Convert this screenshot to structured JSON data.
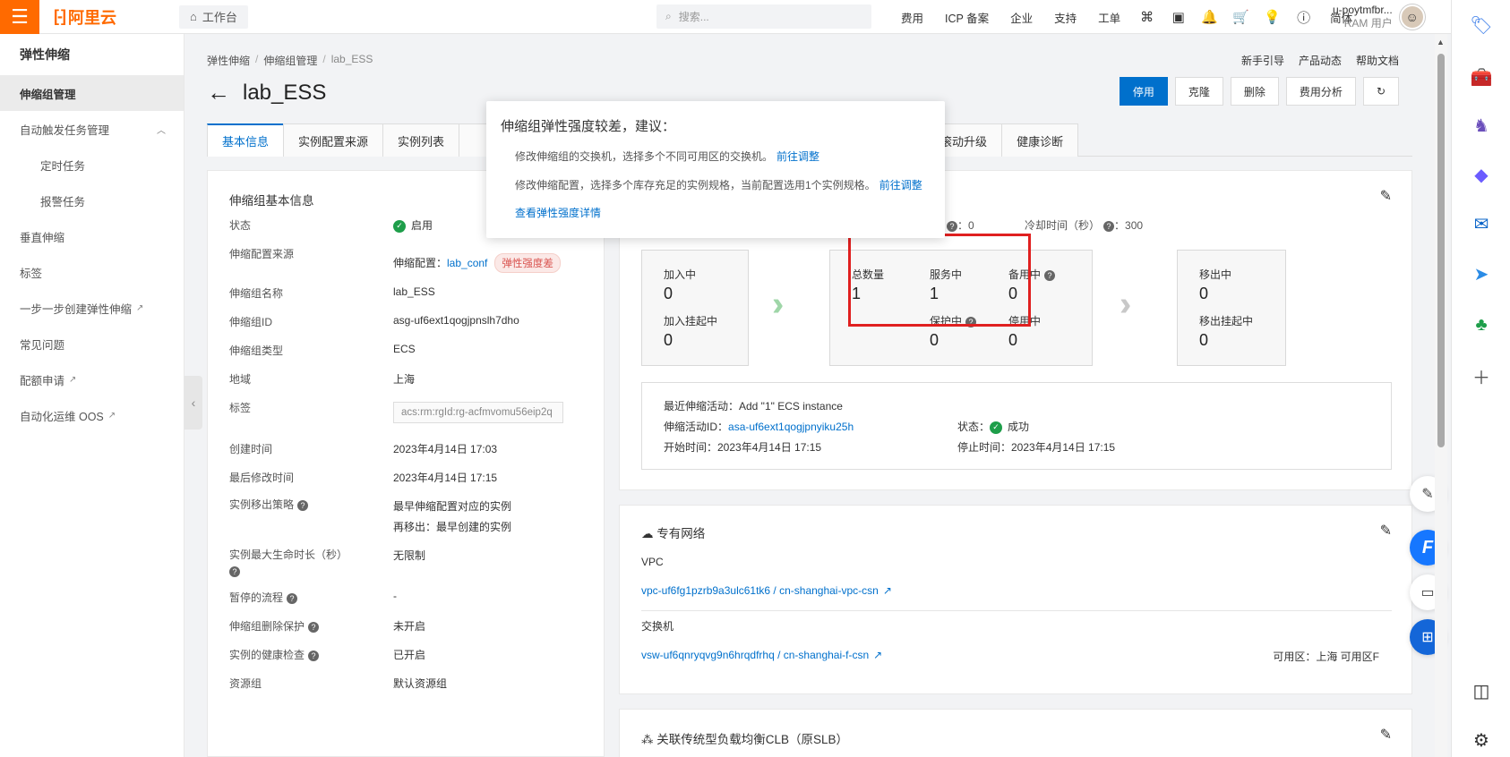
{
  "topbar": {
    "logo": "阿里云",
    "workbench": "工作台",
    "search_placeholder": "搜索...",
    "nav": [
      "费用",
      "ICP 备案",
      "企业",
      "支持",
      "工单"
    ],
    "user_name": "u-poytmfbr...",
    "user_role": "RAM 用户",
    "lang": "简体"
  },
  "sidebar": {
    "title": "弹性伸缩",
    "items": [
      {
        "label": "伸缩组管理"
      },
      {
        "label": "自动触发任务管理"
      },
      {
        "label": "定时任务"
      },
      {
        "label": "报警任务"
      },
      {
        "label": "垂直伸缩"
      },
      {
        "label": "标签"
      },
      {
        "label": "一步一步创建弹性伸缩"
      },
      {
        "label": "常见问题"
      },
      {
        "label": "配额申请"
      },
      {
        "label": "自动化运维 OOS"
      }
    ]
  },
  "breadcrumb": [
    "弹性伸缩",
    "伸缩组管理",
    "lab_ESS"
  ],
  "help_links": [
    "新手引导",
    "产品动态",
    "帮助文档"
  ],
  "page_title": "lab_ESS",
  "actions": [
    "停用",
    "克隆",
    "删除",
    "费用分析"
  ],
  "tabs": [
    "基本信息",
    "实例配置来源",
    "实例列表",
    "滚动升级",
    "健康诊断"
  ],
  "basic": {
    "title": "伸缩组基本信息",
    "rows": [
      {
        "k": "状态",
        "v": "启用"
      },
      {
        "k": "伸缩配置来源",
        "v_prefix": "伸缩配置：",
        "v_link": "lab_conf",
        "v_tag": "弹性强度差"
      },
      {
        "k": "伸缩组名称",
        "v": "lab_ESS"
      },
      {
        "k": "伸缩组ID",
        "v": "asg-uf6ext1qogjpnslh7dho"
      },
      {
        "k": "伸缩组类型",
        "v": "ECS"
      },
      {
        "k": "地域",
        "v": "上海"
      },
      {
        "k": "标签",
        "v": "acs:rm:rgId:rg-acfmvomu56eip2q"
      },
      {
        "k": "创建时间",
        "v": "2023年4月14日 17:03"
      },
      {
        "k": "最后修改时间",
        "v": "2023年4月14日 17:15"
      },
      {
        "k": "实例移出策略",
        "v": "最早伸缩配置对应的实例",
        "v2": "再移出：最早创建的实例"
      },
      {
        "k": "实例最大生命时长（秒）",
        "v": "无限制"
      },
      {
        "k": "暂停的流程",
        "v": "-"
      },
      {
        "k": "伸缩组删除保护",
        "v": "未开启"
      },
      {
        "k": "实例的健康检查",
        "v": "已开启"
      },
      {
        "k": "资源组",
        "v": "默认资源组"
      }
    ]
  },
  "status": {
    "expected_suffix": "：0",
    "cooldown_label": "冷却时间（秒）",
    "cooldown_value": "：300",
    "adding": "加入中",
    "adding_val": "0",
    "adding_pending": "加入挂起中",
    "adding_pending_val": "0",
    "total": "总数量",
    "total_val": "1",
    "in_service": "服务中",
    "in_service_val": "1",
    "standby": "备用中",
    "standby_val": "0",
    "protected": "保护中",
    "protected_val": "0",
    "stopped": "停用中",
    "stopped_val": "0",
    "removing": "移出中",
    "removing_val": "0",
    "removing_pending": "移出挂起中",
    "removing_pending_val": "0",
    "recent_activity": "最近伸缩活动：Add \"1\" ECS instance",
    "activity_id_label": "伸缩活动ID：",
    "activity_id": "asa-uf6ext1qogjpnyiku25h",
    "act_status_label": "状态：",
    "act_status": "成功",
    "start_time": "开始时间：2023年4月14日 17:15",
    "stop_time": "停止时间：2023年4月14日 17:15"
  },
  "vpc": {
    "title": "专有网络",
    "vpc_label": "VPC",
    "vpc_link": "vpc-uf6fg1pzrb9a3ulc61tk6 / cn-shanghai-vpc-csn",
    "vsw_label": "交换机",
    "vsw_link": "vsw-uf6qnryqvg9n6hrqdfrhq / cn-shanghai-f-csn",
    "zone": "可用区：上海 可用区F"
  },
  "clb": {
    "title": "关联传统型负载均衡CLB（原SLB）"
  },
  "popover": {
    "title": "伸缩组弹性强度较差，建议：",
    "line1": "修改伸缩组的交换机，选择多个不同可用区的交换机。",
    "line1_link": "前往调整",
    "line2": "修改伸缩配置，选择多个库存充足的实例规格，当前配置选用1个实例规格。",
    "line2_link": "前往调整",
    "detail_link": "查看弹性强度详情"
  }
}
